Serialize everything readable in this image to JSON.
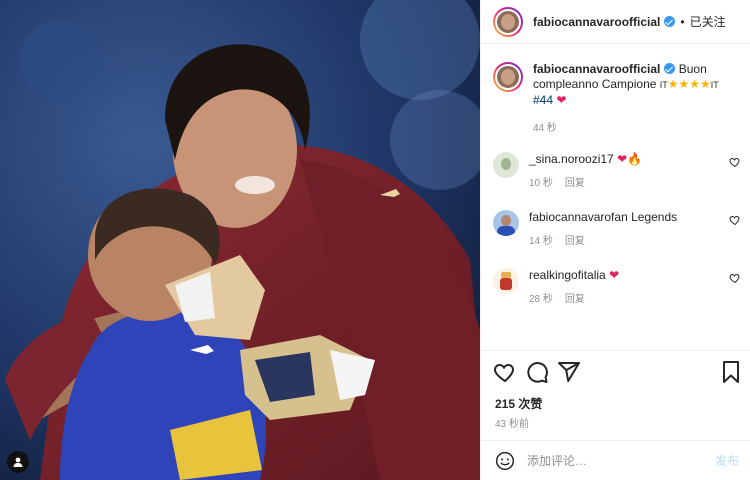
{
  "header": {
    "username": "fabiocannavaroofficial",
    "separator": "•",
    "follow_label": "已关注"
  },
  "caption": {
    "username": "fabiocannavaroofficial",
    "text": "Buon compleanno Campione",
    "flag_1": "IT",
    "stars": "★★★★",
    "flag_2": "IT",
    "hashtag": "#44",
    "time": "44 秒"
  },
  "comments": [
    {
      "username": "_sina.noroozi17",
      "text": "",
      "emoji": "❤🔥",
      "time": "10 秒",
      "reply": "回复"
    },
    {
      "username": "fabiocannavarofan",
      "text": "Legends",
      "emoji": "",
      "time": "14 秒",
      "reply": "回复"
    },
    {
      "username": "realkingofitalia",
      "text": "",
      "emoji": "❤",
      "time": "28 秒",
      "reply": "回复"
    }
  ],
  "stats": {
    "likes": "215 次赞",
    "posted": "43 秒前"
  },
  "composer": {
    "placeholder": "添加评论…",
    "post_label": "发布"
  },
  "colors": {
    "accent_blue": "#3897f0",
    "heart_red": "#e0245e",
    "post_disabled": "#b2dffc",
    "muted_text": "#8e8e8e"
  },
  "icons": [
    "verified-badge-icon",
    "heart-icon",
    "comment-icon",
    "share-icon",
    "bookmark-icon",
    "emoji-icon",
    "user-tag-icon"
  ]
}
